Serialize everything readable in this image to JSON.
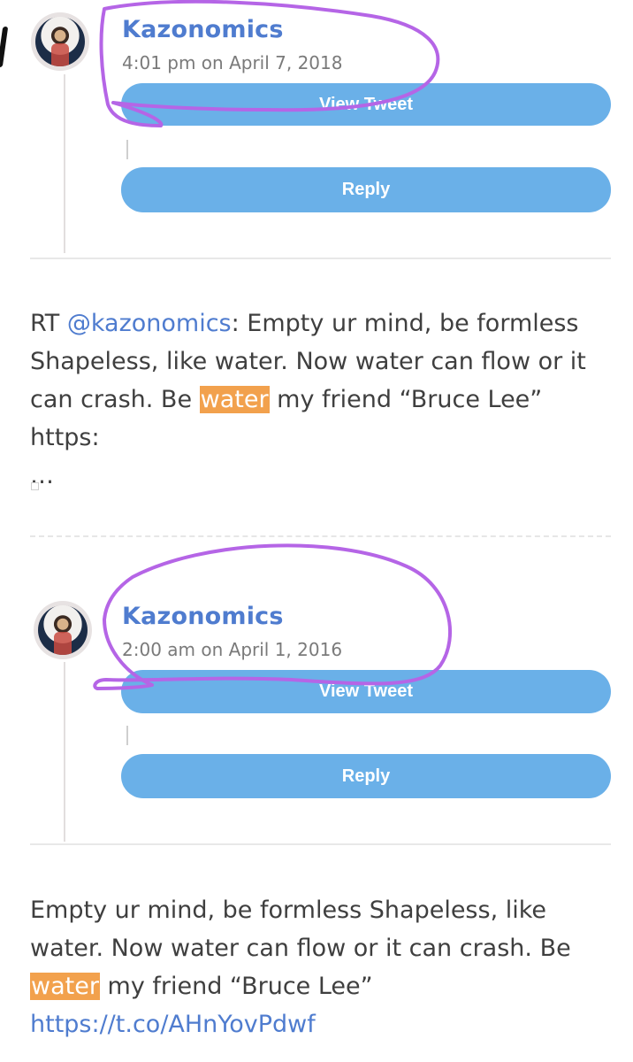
{
  "tweets": [
    {
      "author": "Kazonomics",
      "timestamp": "4:01 pm on April 7, 2018",
      "view_label": "View Tweet",
      "reply_label": "Reply",
      "text_prefix": "RT ",
      "mention": "@kazonomics",
      "text_before_highlight": ": Empty ur mind, be formless Shapeless, like water. Now water can flow or it can crash. Be ",
      "highlight": "water",
      "text_after_highlight": " my friend “Bruce Lee” https:",
      "ellipsis": "…"
    },
    {
      "author": "Kazonomics",
      "timestamp": "2:00 am on April 1, 2016",
      "view_label": "View Tweet",
      "reply_label": "Reply",
      "text_before_highlight": "Empty ur mind, be formless Shapeless, like water. Now water can flow or it can crash. Be ",
      "highlight": "water",
      "text_after_highlight": " my friend “Bruce Lee”",
      "link": "https://t.co/AHnYovPdwf"
    }
  ],
  "colors": {
    "accent_blue": "#4f7ccf",
    "button_blue": "#6ab0e8",
    "highlight_orange": "#f2a14d",
    "annotation_purple": "#b565e6"
  }
}
